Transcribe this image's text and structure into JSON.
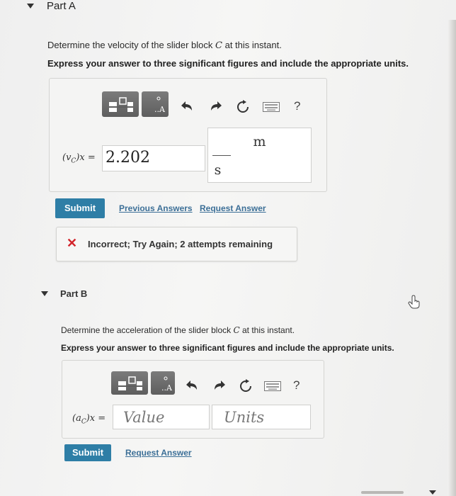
{
  "partA": {
    "title": "Part A",
    "question": "Determine the velocity of the slider block",
    "question_var": "C",
    "question_end": "at this instant.",
    "instruction": "Express your answer to three significant figures and include the appropriate units.",
    "label": "(v",
    "label_sub": "C",
    "label_end": ")x =",
    "value": "2.202",
    "unit_numerator": "m",
    "unit_denominator": "s",
    "submit_label": "Submit",
    "previous_answers_label": "Previous Answers",
    "request_answer_label": "Request Answer",
    "feedback_icon": "✕",
    "feedback": "Incorrect; Try Again; 2 attempts remaining"
  },
  "partB": {
    "title": "Part B",
    "question": "Determine the acceleration of the slider block",
    "question_var": "C",
    "question_end": "at this instant.",
    "instruction": "Express your answer to three significant figures and include the appropriate units.",
    "label": "(a",
    "label_sub": "C",
    "label_end": ")x =",
    "value_placeholder": "Value",
    "units_placeholder": "Units",
    "submit_label": "Submit",
    "request_answer_label": "Request Answer"
  },
  "toolbar": {
    "help_label": "?",
    "icons": [
      "templates-icon",
      "symbols-icon",
      "undo-icon",
      "redo-icon",
      "reset-icon",
      "keyboard-icon",
      "help-icon"
    ]
  },
  "colors": {
    "submit": "#2e7ea6",
    "link": "#3c6f97",
    "error": "#d2232a"
  }
}
